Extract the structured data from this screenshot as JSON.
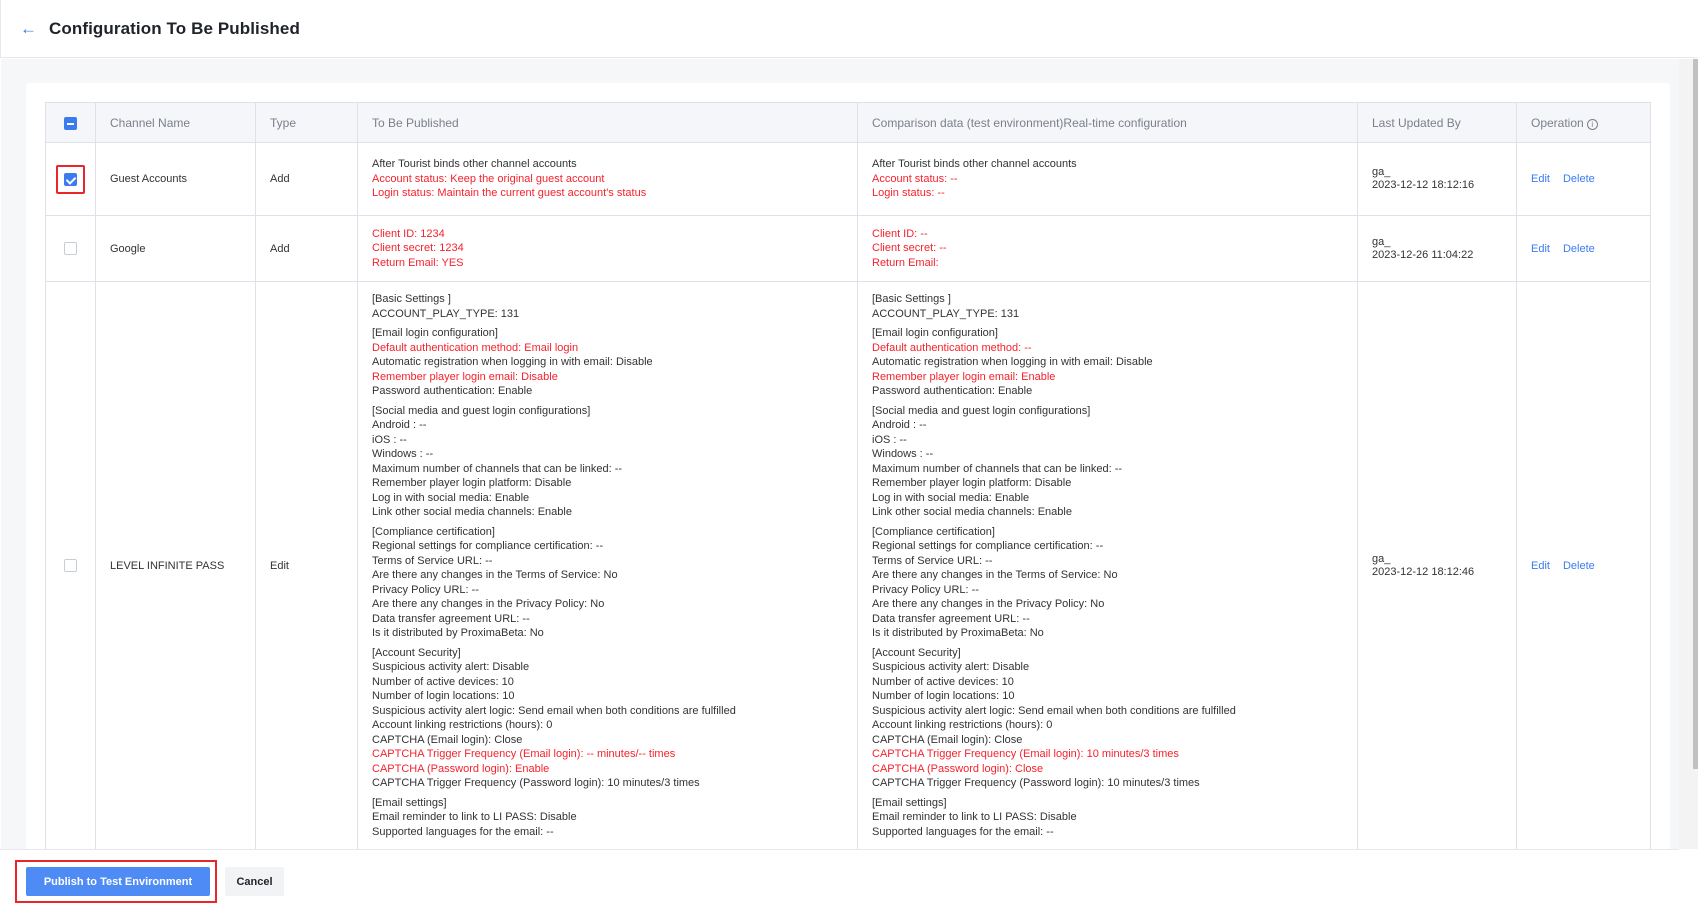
{
  "header": {
    "title": "Configuration To Be Published",
    "back_icon": "arrow-left-icon"
  },
  "table": {
    "columns": [
      "",
      "Channel Name",
      "Type",
      "To Be Published",
      "Comparison data (test environment)Real-time configuration",
      "Last Updated By",
      "Operation"
    ],
    "operation_info_icon": "info-circle-icon",
    "select_all_state": "partial",
    "rows": [
      {
        "checked": true,
        "channel": "Guest Accounts",
        "type": "Add",
        "to_publish": [
          [
            {
              "text": "After Tourist binds other channel accounts",
              "changed": false
            },
            {
              "text": "Account status: Keep the original guest account",
              "changed": true
            },
            {
              "text": "Login status: Maintain the current guest account's status",
              "changed": true
            }
          ]
        ],
        "comparison": [
          [
            {
              "text": "After Tourist binds other channel accounts",
              "changed": false
            },
            {
              "text": "Account status: --",
              "changed": true
            },
            {
              "text": "Login status: --",
              "changed": true
            }
          ]
        ],
        "updated_by": "ga_",
        "updated_at": "2023-12-12 18:12:16",
        "actions": [
          "Edit",
          "Delete"
        ]
      },
      {
        "checked": false,
        "channel": "Google",
        "type": "Add",
        "to_publish": [
          [
            {
              "text": "Client ID: 1234",
              "changed": true
            },
            {
              "text": "Client secret: 1234",
              "changed": true
            },
            {
              "text": "Return Email: YES",
              "changed": true
            }
          ]
        ],
        "comparison": [
          [
            {
              "text": "Client ID: --",
              "changed": true
            },
            {
              "text": "Client secret: --",
              "changed": true
            },
            {
              "text": "Return Email:",
              "changed": true
            }
          ]
        ],
        "updated_by": "ga_",
        "updated_at": "2023-12-26 11:04:22",
        "actions": [
          "Edit",
          "Delete"
        ]
      },
      {
        "checked": false,
        "channel": "LEVEL INFINITE PASS",
        "type": "Edit",
        "to_publish": [
          [
            {
              "text": "[Basic Settings ]",
              "changed": false
            },
            {
              "text": "ACCOUNT_PLAY_TYPE: 131",
              "changed": false
            }
          ],
          [
            {
              "text": "[Email login configuration]",
              "changed": false
            },
            {
              "text": "Default authentication method: Email login",
              "changed": true
            },
            {
              "text": "Automatic registration when logging in with email: Disable",
              "changed": false
            },
            {
              "text": "Remember player login email: Disable",
              "changed": true
            },
            {
              "text": "Password authentication: Enable",
              "changed": false
            }
          ],
          [
            {
              "text": "[Social media and guest login configurations]",
              "changed": false
            },
            {
              "text": "Android : --",
              "changed": false
            },
            {
              "text": "iOS : --",
              "changed": false
            },
            {
              "text": "Windows : --",
              "changed": false
            },
            {
              "text": "Maximum number of channels that can be linked: --",
              "changed": false
            },
            {
              "text": "Remember player login platform: Disable",
              "changed": false
            },
            {
              "text": "Log in with social media: Enable",
              "changed": false
            },
            {
              "text": "Link other social media channels: Enable",
              "changed": false
            }
          ],
          [
            {
              "text": "[Compliance certification]",
              "changed": false
            },
            {
              "text": "Regional settings for compliance certification: --",
              "changed": false
            },
            {
              "text": "Terms of Service URL: --",
              "changed": false
            },
            {
              "text": "Are there any changes in the Terms of Service: No",
              "changed": false
            },
            {
              "text": "Privacy Policy URL: --",
              "changed": false
            },
            {
              "text": "Are there any changes in the Privacy Policy: No",
              "changed": false
            },
            {
              "text": "Data transfer agreement URL: --",
              "changed": false
            },
            {
              "text": "Is it distributed by ProximaBeta: No",
              "changed": false
            }
          ],
          [
            {
              "text": "[Account Security]",
              "changed": false
            },
            {
              "text": "Suspicious activity alert: Disable",
              "changed": false
            },
            {
              "text": "Number of active devices: 10",
              "changed": false
            },
            {
              "text": "Number of login locations: 10",
              "changed": false
            },
            {
              "text": "Suspicious activity alert logic: Send email when both conditions are fulfilled",
              "changed": false
            },
            {
              "text": "Account linking restrictions (hours): 0",
              "changed": false
            },
            {
              "text": "CAPTCHA (Email login): Close",
              "changed": false
            },
            {
              "text": "CAPTCHA Trigger Frequency (Email login): -- minutes/-- times",
              "changed": true
            },
            {
              "text": "CAPTCHA (Password login): Enable",
              "changed": true
            },
            {
              "text": "CAPTCHA Trigger Frequency (Password login): 10 minutes/3 times",
              "changed": false
            }
          ],
          [
            {
              "text": "[Email settings]",
              "changed": false
            },
            {
              "text": "Email reminder to link to LI PASS: Disable",
              "changed": false
            },
            {
              "text": "Supported languages for the email: --",
              "changed": false
            }
          ]
        ],
        "comparison": [
          [
            {
              "text": "[Basic Settings ]",
              "changed": false
            },
            {
              "text": "ACCOUNT_PLAY_TYPE: 131",
              "changed": false
            }
          ],
          [
            {
              "text": "[Email login configuration]",
              "changed": false
            },
            {
              "text": "Default authentication method: --",
              "changed": true
            },
            {
              "text": "Automatic registration when logging in with email: Disable",
              "changed": false
            },
            {
              "text": "Remember player login email: Enable",
              "changed": true
            },
            {
              "text": "Password authentication: Enable",
              "changed": false
            }
          ],
          [
            {
              "text": "[Social media and guest login configurations]",
              "changed": false
            },
            {
              "text": "Android : --",
              "changed": false
            },
            {
              "text": "iOS : --",
              "changed": false
            },
            {
              "text": "Windows : --",
              "changed": false
            },
            {
              "text": "Maximum number of channels that can be linked: --",
              "changed": false
            },
            {
              "text": "Remember player login platform: Disable",
              "changed": false
            },
            {
              "text": "Log in with social media: Enable",
              "changed": false
            },
            {
              "text": "Link other social media channels: Enable",
              "changed": false
            }
          ],
          [
            {
              "text": "[Compliance certification]",
              "changed": false
            },
            {
              "text": "Regional settings for compliance certification: --",
              "changed": false
            },
            {
              "text": "Terms of Service URL: --",
              "changed": false
            },
            {
              "text": "Are there any changes in the Terms of Service: No",
              "changed": false
            },
            {
              "text": "Privacy Policy URL: --",
              "changed": false
            },
            {
              "text": "Are there any changes in the Privacy Policy: No",
              "changed": false
            },
            {
              "text": "Data transfer agreement URL: --",
              "changed": false
            },
            {
              "text": "Is it distributed by ProximaBeta: No",
              "changed": false
            }
          ],
          [
            {
              "text": "[Account Security]",
              "changed": false
            },
            {
              "text": "Suspicious activity alert: Disable",
              "changed": false
            },
            {
              "text": "Number of active devices: 10",
              "changed": false
            },
            {
              "text": "Number of login locations: 10",
              "changed": false
            },
            {
              "text": "Suspicious activity alert logic: Send email when both conditions are fulfilled",
              "changed": false
            },
            {
              "text": "Account linking restrictions (hours): 0",
              "changed": false
            },
            {
              "text": "CAPTCHA (Email login): Close",
              "changed": false
            },
            {
              "text": "CAPTCHA Trigger Frequency (Email login): 10 minutes/3 times",
              "changed": true
            },
            {
              "text": "CAPTCHA (Password login): Close",
              "changed": true
            },
            {
              "text": "CAPTCHA Trigger Frequency (Password login): 10 minutes/3 times",
              "changed": false
            }
          ],
          [
            {
              "text": "[Email settings]",
              "changed": false
            },
            {
              "text": "Email reminder to link to LI PASS: Disable",
              "changed": false
            },
            {
              "text": "Supported languages for the email: --",
              "changed": false
            }
          ]
        ],
        "updated_by": "ga_",
        "updated_at": "2023-12-12 18:12:46",
        "actions": [
          "Edit",
          "Delete"
        ]
      }
    ]
  },
  "footer": {
    "publish_label": "Publish to Test Environment",
    "cancel_label": "Cancel"
  },
  "colors": {
    "accent": "#3a7bf0",
    "changed_text": "#f5222d",
    "highlight_box": "#e8262b",
    "publish_button": "#4e8bf5"
  }
}
